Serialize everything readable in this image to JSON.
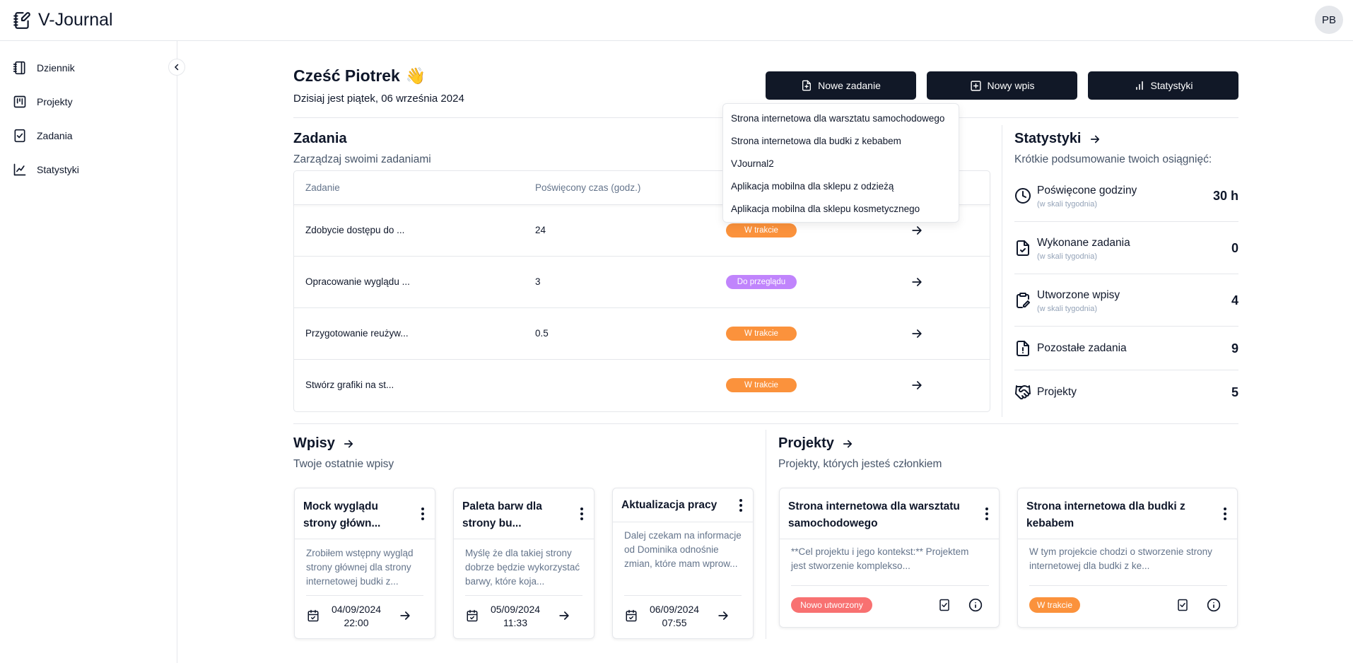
{
  "app": {
    "title": "V-Journal",
    "avatar_initials": "PB"
  },
  "sidebar": {
    "items": [
      {
        "label": "Dziennik",
        "icon": "notebook-icon"
      },
      {
        "label": "Projekty",
        "icon": "kanban-icon"
      },
      {
        "label": "Zadania",
        "icon": "checklist-icon"
      },
      {
        "label": "Statystyki",
        "icon": "chart-line-icon"
      }
    ]
  },
  "greeting": {
    "title": "Cześć Piotrek",
    "emoji": "👋",
    "date": "Dzisiaj jest piątek, 06 września 2024"
  },
  "actions": {
    "new_task": "Nowe zadanie",
    "new_entry": "Nowy wpis",
    "stats": "Statystyki"
  },
  "dropdown": {
    "items": [
      "Strona internetowa dla warsztatu samochodowego",
      "Strona internetowa dla budki z kebabem",
      "VJournal2",
      "Aplikacja mobilna dla sklepu z odzieżą",
      "Aplikacja mobilna dla sklepu kosmetycznego"
    ]
  },
  "tasks": {
    "title": "Zadania",
    "subtitle": "Zarządzaj swoimi zadaniami",
    "columns": {
      "task": "Zadanie",
      "time": "Poświęcony czas (godz.)"
    },
    "rows": [
      {
        "name": "Zdobycie dostępu do ...",
        "time": "24",
        "status": "W trakcie",
        "status_color": "#fb923c"
      },
      {
        "name": "Opracowanie wyglądu ...",
        "time": "3",
        "status": "Do przeglądu",
        "status_color": "#c084fc"
      },
      {
        "name": "Przygotowanie reużyw...",
        "time": "0.5",
        "status": "W trakcie",
        "status_color": "#fb923c"
      },
      {
        "name": "Stwórz grafiki na st...",
        "time": "",
        "status": "W trakcie",
        "status_color": "#fb923c"
      }
    ]
  },
  "stats": {
    "title": "Statystyki",
    "subtitle": "Krótkie podsumowanie twoich osiągnięć:",
    "items": [
      {
        "label": "Poświęcone godziny",
        "sub": "(w skali tygodnia)",
        "value": "30 h",
        "icon": "clock-icon"
      },
      {
        "label": "Wykonane zadania",
        "sub": "(w skali tygodnia)",
        "value": "0",
        "icon": "file-check-icon"
      },
      {
        "label": "Utworzone wpisy",
        "sub": "(w skali tygodnia)",
        "value": "4",
        "icon": "clipboard-pen-icon"
      },
      {
        "label": "Pozostałe zadania",
        "sub": "",
        "value": "9",
        "icon": "file-alert-icon"
      },
      {
        "label": "Projekty",
        "sub": "",
        "value": "5",
        "icon": "handshake-icon"
      }
    ]
  },
  "entries": {
    "title": "Wpisy",
    "subtitle": "Twoje ostatnie wpisy",
    "cards": [
      {
        "title_l1": "Mock wyglądu",
        "title_l2": "strony główn...",
        "body": [
          "Zrobiłem wstępny wygląd",
          "strony głównej dla strony",
          "internetowej budki z..."
        ],
        "date": "04/09/2024",
        "time": "22:00"
      },
      {
        "title_l1": "Paleta barw dla",
        "title_l2": "strony bu...",
        "body": [
          "Myślę że dla takiej strony",
          "dobrze będzie wykorzystać",
          "barwy, które koja..."
        ],
        "date": "05/09/2024",
        "time": "11:33"
      },
      {
        "title_l1": "Aktualizacja pracy",
        "title_l2": "",
        "body": [
          "Dalej czekam na informacje",
          "od Dominika odnośnie",
          "zmian, które mam wprow..."
        ],
        "date": "06/09/2024",
        "time": "07:55"
      }
    ]
  },
  "projects": {
    "title": "Projekty",
    "subtitle": "Projekty, których jesteś członkiem",
    "cards": [
      {
        "title_l1": "Strona internetowa dla warsztatu",
        "title_l2": "samochodowego",
        "body": [
          "**Cel projektu i jego kontekst:** Projektem",
          "jest stworzenie komplekso..."
        ],
        "status": "Nowo utworzony",
        "status_color": "#f87171"
      },
      {
        "title_l1": "Strona internetowa dla budki z",
        "title_l2": "kebabem",
        "body": [
          "W tym projekcie chodzi o stworzenie strony",
          "internetowej dla budki z ke..."
        ],
        "status": "W trakcie",
        "status_color": "#fb923c"
      }
    ]
  }
}
